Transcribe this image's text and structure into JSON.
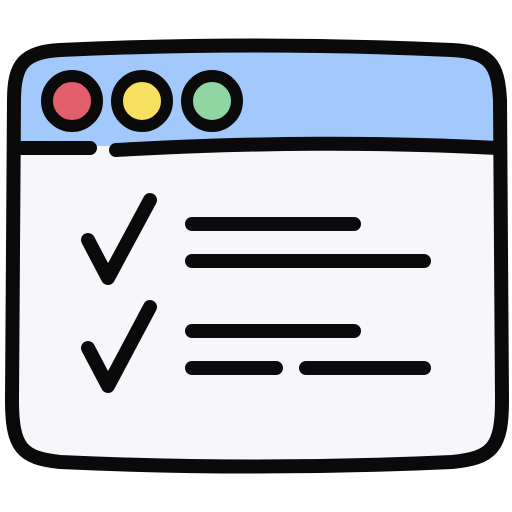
{
  "icon": {
    "name": "browser-checklist-icon",
    "colors": {
      "outline": "#0a0a0a",
      "title_bar": "#a3c8fb",
      "content_bg": "#f7f6fa",
      "dot_red": "#e2606b",
      "dot_yellow": "#f7e060",
      "dot_green": "#8fd6a3"
    }
  }
}
